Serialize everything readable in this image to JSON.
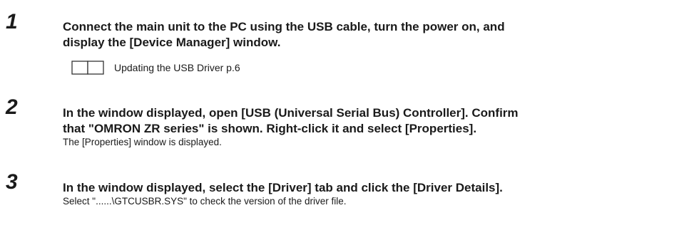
{
  "steps": [
    {
      "number": "1",
      "title_lines": [
        "Connect the main unit to the PC using the USB cable, turn the power on, and",
        "display the [Device Manager] window."
      ],
      "reference": {
        "icon": "manual-book-icon",
        "text": "Updating the USB Driver p.6"
      }
    },
    {
      "number": "2",
      "title_lines": [
        "In the window displayed, open [USB (Universal Serial Bus) Controller]. Confirm",
        "that \"OMRON ZR series\" is shown. Right-click it and select [Properties]."
      ],
      "note": "The [Properties] window is displayed."
    },
    {
      "number": "3",
      "title_lines": [
        "In the window displayed, select the [Driver] tab and click the [Driver Details]."
      ],
      "note": "Select \"......\\GTCUSBR.SYS\" to check the version of the driver file."
    }
  ]
}
